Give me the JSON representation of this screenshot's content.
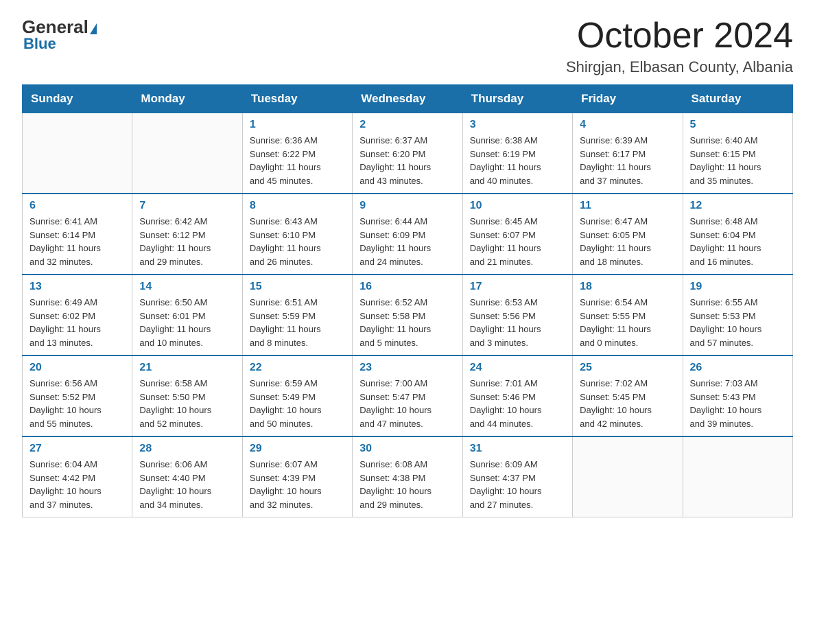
{
  "header": {
    "logo_general": "General",
    "logo_blue": "Blue",
    "month_title": "October 2024",
    "location": "Shirgjan, Elbasan County, Albania"
  },
  "weekdays": [
    "Sunday",
    "Monday",
    "Tuesday",
    "Wednesday",
    "Thursday",
    "Friday",
    "Saturday"
  ],
  "weeks": [
    [
      {
        "day": "",
        "info": ""
      },
      {
        "day": "",
        "info": ""
      },
      {
        "day": "1",
        "info": "Sunrise: 6:36 AM\nSunset: 6:22 PM\nDaylight: 11 hours\nand 45 minutes."
      },
      {
        "day": "2",
        "info": "Sunrise: 6:37 AM\nSunset: 6:20 PM\nDaylight: 11 hours\nand 43 minutes."
      },
      {
        "day": "3",
        "info": "Sunrise: 6:38 AM\nSunset: 6:19 PM\nDaylight: 11 hours\nand 40 minutes."
      },
      {
        "day": "4",
        "info": "Sunrise: 6:39 AM\nSunset: 6:17 PM\nDaylight: 11 hours\nand 37 minutes."
      },
      {
        "day": "5",
        "info": "Sunrise: 6:40 AM\nSunset: 6:15 PM\nDaylight: 11 hours\nand 35 minutes."
      }
    ],
    [
      {
        "day": "6",
        "info": "Sunrise: 6:41 AM\nSunset: 6:14 PM\nDaylight: 11 hours\nand 32 minutes."
      },
      {
        "day": "7",
        "info": "Sunrise: 6:42 AM\nSunset: 6:12 PM\nDaylight: 11 hours\nand 29 minutes."
      },
      {
        "day": "8",
        "info": "Sunrise: 6:43 AM\nSunset: 6:10 PM\nDaylight: 11 hours\nand 26 minutes."
      },
      {
        "day": "9",
        "info": "Sunrise: 6:44 AM\nSunset: 6:09 PM\nDaylight: 11 hours\nand 24 minutes."
      },
      {
        "day": "10",
        "info": "Sunrise: 6:45 AM\nSunset: 6:07 PM\nDaylight: 11 hours\nand 21 minutes."
      },
      {
        "day": "11",
        "info": "Sunrise: 6:47 AM\nSunset: 6:05 PM\nDaylight: 11 hours\nand 18 minutes."
      },
      {
        "day": "12",
        "info": "Sunrise: 6:48 AM\nSunset: 6:04 PM\nDaylight: 11 hours\nand 16 minutes."
      }
    ],
    [
      {
        "day": "13",
        "info": "Sunrise: 6:49 AM\nSunset: 6:02 PM\nDaylight: 11 hours\nand 13 minutes."
      },
      {
        "day": "14",
        "info": "Sunrise: 6:50 AM\nSunset: 6:01 PM\nDaylight: 11 hours\nand 10 minutes."
      },
      {
        "day": "15",
        "info": "Sunrise: 6:51 AM\nSunset: 5:59 PM\nDaylight: 11 hours\nand 8 minutes."
      },
      {
        "day": "16",
        "info": "Sunrise: 6:52 AM\nSunset: 5:58 PM\nDaylight: 11 hours\nand 5 minutes."
      },
      {
        "day": "17",
        "info": "Sunrise: 6:53 AM\nSunset: 5:56 PM\nDaylight: 11 hours\nand 3 minutes."
      },
      {
        "day": "18",
        "info": "Sunrise: 6:54 AM\nSunset: 5:55 PM\nDaylight: 11 hours\nand 0 minutes."
      },
      {
        "day": "19",
        "info": "Sunrise: 6:55 AM\nSunset: 5:53 PM\nDaylight: 10 hours\nand 57 minutes."
      }
    ],
    [
      {
        "day": "20",
        "info": "Sunrise: 6:56 AM\nSunset: 5:52 PM\nDaylight: 10 hours\nand 55 minutes."
      },
      {
        "day": "21",
        "info": "Sunrise: 6:58 AM\nSunset: 5:50 PM\nDaylight: 10 hours\nand 52 minutes."
      },
      {
        "day": "22",
        "info": "Sunrise: 6:59 AM\nSunset: 5:49 PM\nDaylight: 10 hours\nand 50 minutes."
      },
      {
        "day": "23",
        "info": "Sunrise: 7:00 AM\nSunset: 5:47 PM\nDaylight: 10 hours\nand 47 minutes."
      },
      {
        "day": "24",
        "info": "Sunrise: 7:01 AM\nSunset: 5:46 PM\nDaylight: 10 hours\nand 44 minutes."
      },
      {
        "day": "25",
        "info": "Sunrise: 7:02 AM\nSunset: 5:45 PM\nDaylight: 10 hours\nand 42 minutes."
      },
      {
        "day": "26",
        "info": "Sunrise: 7:03 AM\nSunset: 5:43 PM\nDaylight: 10 hours\nand 39 minutes."
      }
    ],
    [
      {
        "day": "27",
        "info": "Sunrise: 6:04 AM\nSunset: 4:42 PM\nDaylight: 10 hours\nand 37 minutes."
      },
      {
        "day": "28",
        "info": "Sunrise: 6:06 AM\nSunset: 4:40 PM\nDaylight: 10 hours\nand 34 minutes."
      },
      {
        "day": "29",
        "info": "Sunrise: 6:07 AM\nSunset: 4:39 PM\nDaylight: 10 hours\nand 32 minutes."
      },
      {
        "day": "30",
        "info": "Sunrise: 6:08 AM\nSunset: 4:38 PM\nDaylight: 10 hours\nand 29 minutes."
      },
      {
        "day": "31",
        "info": "Sunrise: 6:09 AM\nSunset: 4:37 PM\nDaylight: 10 hours\nand 27 minutes."
      },
      {
        "day": "",
        "info": ""
      },
      {
        "day": "",
        "info": ""
      }
    ]
  ]
}
